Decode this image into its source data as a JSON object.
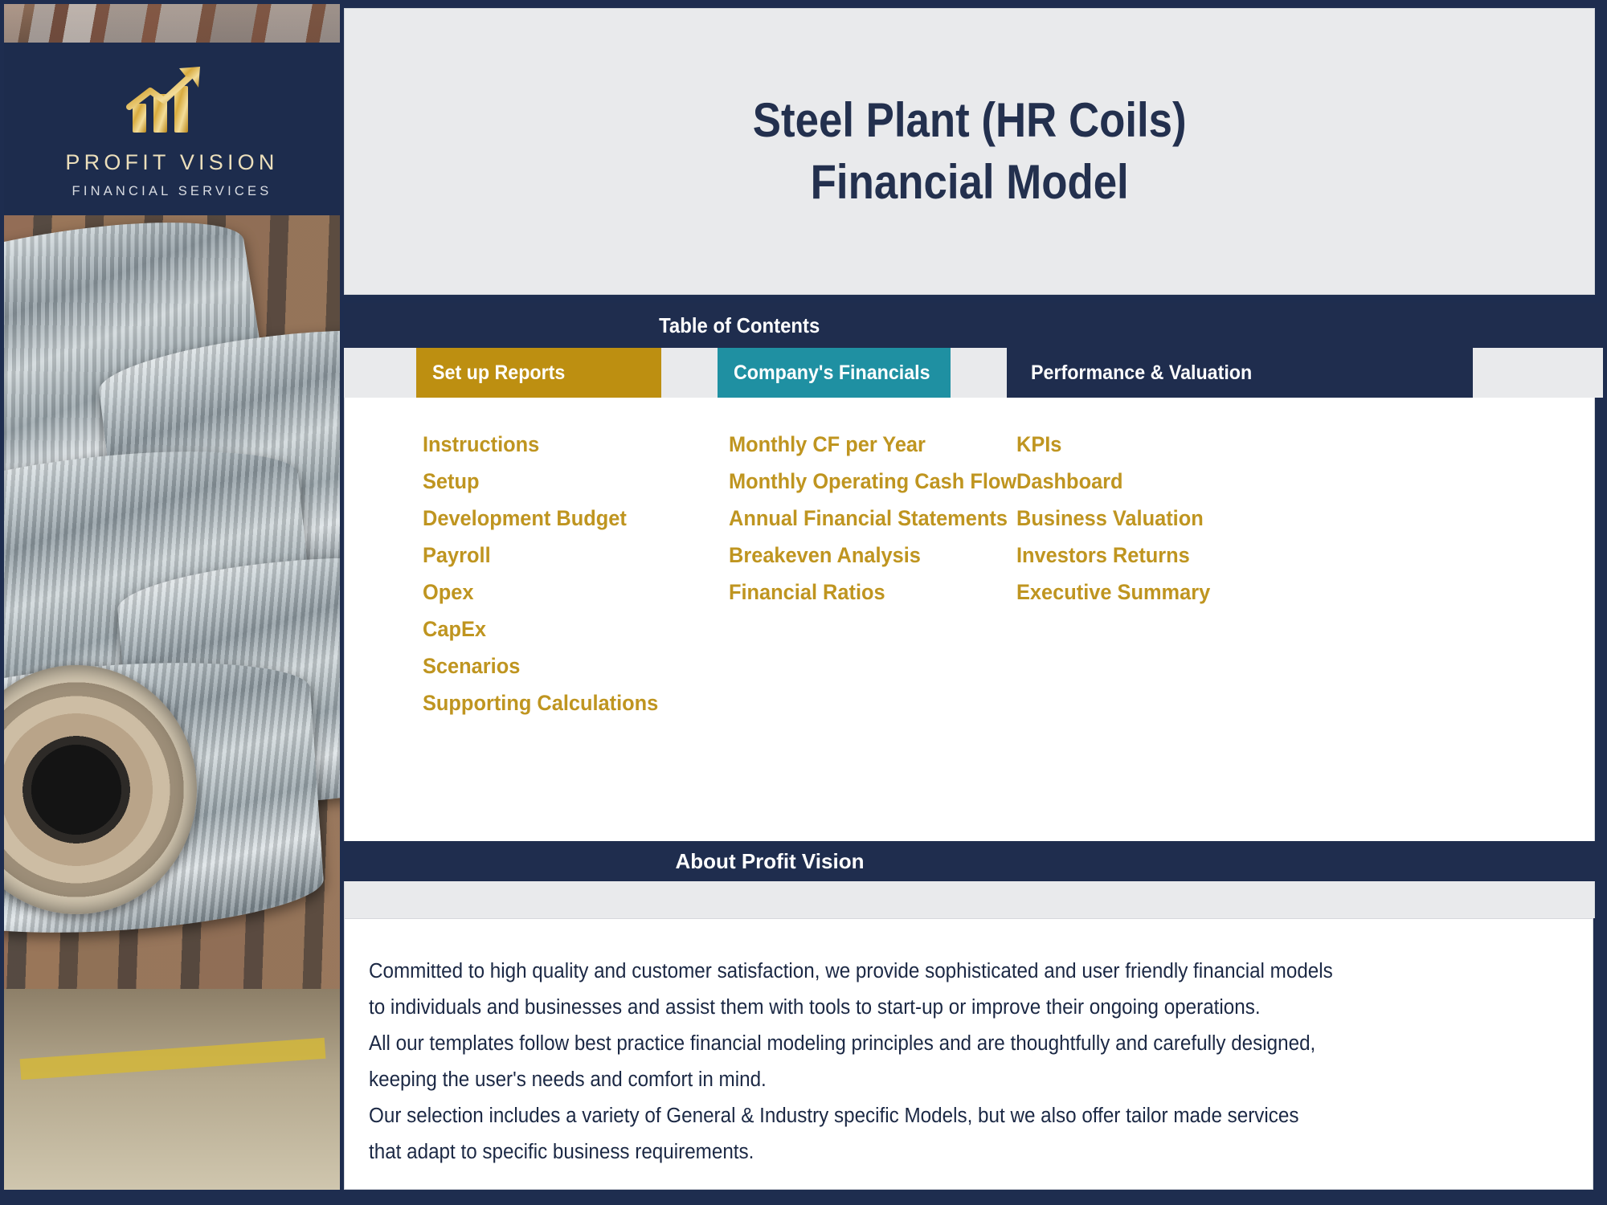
{
  "brand": {
    "name": "PROFIT VISION",
    "tagline": "FINANCIAL SERVICES",
    "logo_icon": "growth-bar-chart-arrow-icon"
  },
  "header": {
    "title_line1": "Steel Plant (HR Coils)",
    "title_line2": "Financial Model"
  },
  "toc": {
    "band_label": "Table of Contents",
    "categories": [
      {
        "label": "Set up Reports",
        "color": "#bd8f11"
      },
      {
        "label": "Company's Financials",
        "color": "#1f90a2"
      },
      {
        "label": "Performance & Valuation",
        "color": "#1f2d4e"
      }
    ],
    "columns": [
      {
        "links": [
          "Instructions",
          "Setup",
          "Development Budget",
          "Payroll",
          "Opex",
          "CapEx",
          "Scenarios",
          "Supporting Calculations"
        ]
      },
      {
        "links": [
          "Monthly CF per Year",
          "Monthly Operating Cash Flow",
          "Annual Financial Statements",
          "Breakeven Analysis",
          "Financial Ratios"
        ]
      },
      {
        "links": [
          "KPIs",
          "Dashboard",
          "Business Valuation",
          "Investors Returns",
          "Executive Summary"
        ]
      }
    ]
  },
  "about": {
    "band_label": "About Profit Vision",
    "paragraphs": [
      "Committed to high quality and customer satisfaction, we provide sophisticated and user friendly financial models",
      "to individuals and businesses and assist them  with tools to start-up or improve their ongoing operations.",
      "All our templates follow best practice financial modeling principles and are thoughtfully and carefully designed,",
      "keeping the user's needs and comfort in mind.",
      "Our selection includes a variety of General & Industry specific Models, but we also offer tailor made services",
      "that adapt to specific business requirements."
    ]
  },
  "colors": {
    "navy": "#1f2d4e",
    "gold": "#bd8f11",
    "teal": "#1f90a2",
    "link_gold": "#bf9520",
    "panel_gray": "#e9eaec"
  }
}
